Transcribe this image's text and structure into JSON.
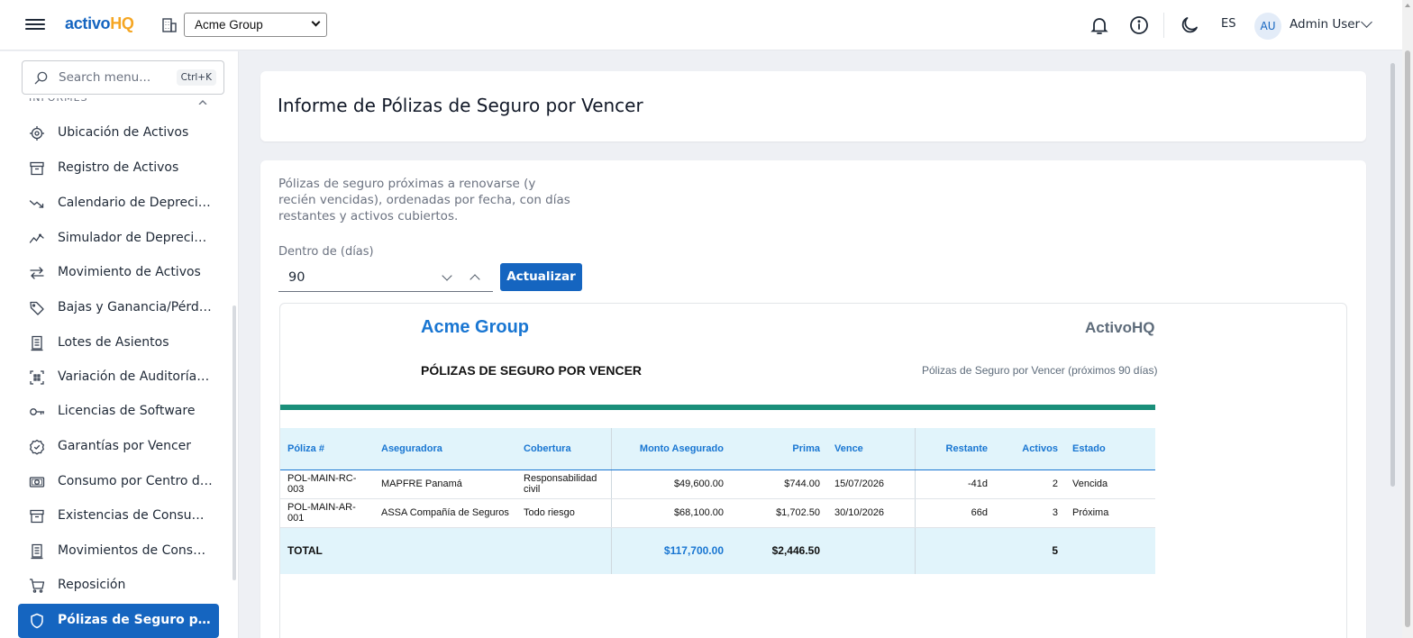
{
  "header": {
    "logo_part1": "activo",
    "logo_part2": "HQ",
    "organization": "Acme Group",
    "language": "ES",
    "avatar_initials": "AU",
    "user_name": "Admin User"
  },
  "sidebar": {
    "search_placeholder": "Search menu...",
    "search_shortcut": "Ctrl+K",
    "section_header": "INFORMES",
    "items": [
      {
        "label": "Ubicación de Activos",
        "icon": "target-icon"
      },
      {
        "label": "Registro de Activos",
        "icon": "archive-icon"
      },
      {
        "label": "Calendario de Depreciación",
        "icon": "trending-down-icon"
      },
      {
        "label": "Simulador de Depreciación",
        "icon": "activity-icon"
      },
      {
        "label": "Movimiento de Activos",
        "icon": "arrows-left-right-icon"
      },
      {
        "label": "Bajas y Ganancia/Pérdida",
        "icon": "tag-icon"
      },
      {
        "label": "Lotes de Asientos",
        "icon": "receipt-icon"
      },
      {
        "label": "Variación de Auditoría RFID",
        "icon": "scan-icon"
      },
      {
        "label": "Licencias de Software",
        "icon": "key-icon"
      },
      {
        "label": "Garantías por Vencer",
        "icon": "badge-check-icon"
      },
      {
        "label": "Consumo por Centro de Costo",
        "icon": "cash-icon"
      },
      {
        "label": "Existencias de Consumibles",
        "icon": "box-icon"
      },
      {
        "label": "Movimientos de Consumibles",
        "icon": "receipt-icon"
      },
      {
        "label": "Reposición",
        "icon": "cart-icon"
      },
      {
        "label": "Pólizas de Seguro por Vencer",
        "icon": "shield-icon",
        "active": true
      }
    ]
  },
  "page": {
    "title": "Informe de Pólizas de Seguro por Vencer",
    "description": "Pólizas de seguro próximas a renovarse (y recién vencidas), ordenadas por fecha, con días restantes y activos cubiertos.",
    "within_label": "Dentro de (días)",
    "within_value": "90",
    "refresh_label": "Actualizar"
  },
  "report": {
    "company": "Acme Group",
    "brand": "ActivoHQ",
    "title": "PÓLIZAS DE SEGURO POR VENCER",
    "subtitle": "Pólizas de Seguro por Vencer (próximos 90 días)",
    "accent_color": "#1a8f7a",
    "columns": [
      "Póliza #",
      "Aseguradora",
      "Cobertura",
      "Monto Asegurado",
      "Prima",
      "Vence",
      "Restante",
      "Activos",
      "Estado"
    ],
    "rows": [
      {
        "policy": "POL-MAIN-RC-003",
        "insurer": "MAPFRE Panamá",
        "coverage": "Responsabilidad civil",
        "amount": "$49,600.00",
        "premium": "$744.00",
        "expires": "15/07/2026",
        "remaining": "-41d",
        "assets": "2",
        "status": "Vencida"
      },
      {
        "policy": "POL-MAIN-AR-001",
        "insurer": "ASSA Compañía de Seguros",
        "coverage": "Todo riesgo",
        "amount": "$68,100.00",
        "premium": "$1,702.50",
        "expires": "30/10/2026",
        "remaining": "66d",
        "assets": "3",
        "status": "Próxima"
      }
    ],
    "total": {
      "label": "TOTAL",
      "amount": "$117,700.00",
      "premium": "$2,446.50",
      "assets": "5"
    }
  }
}
